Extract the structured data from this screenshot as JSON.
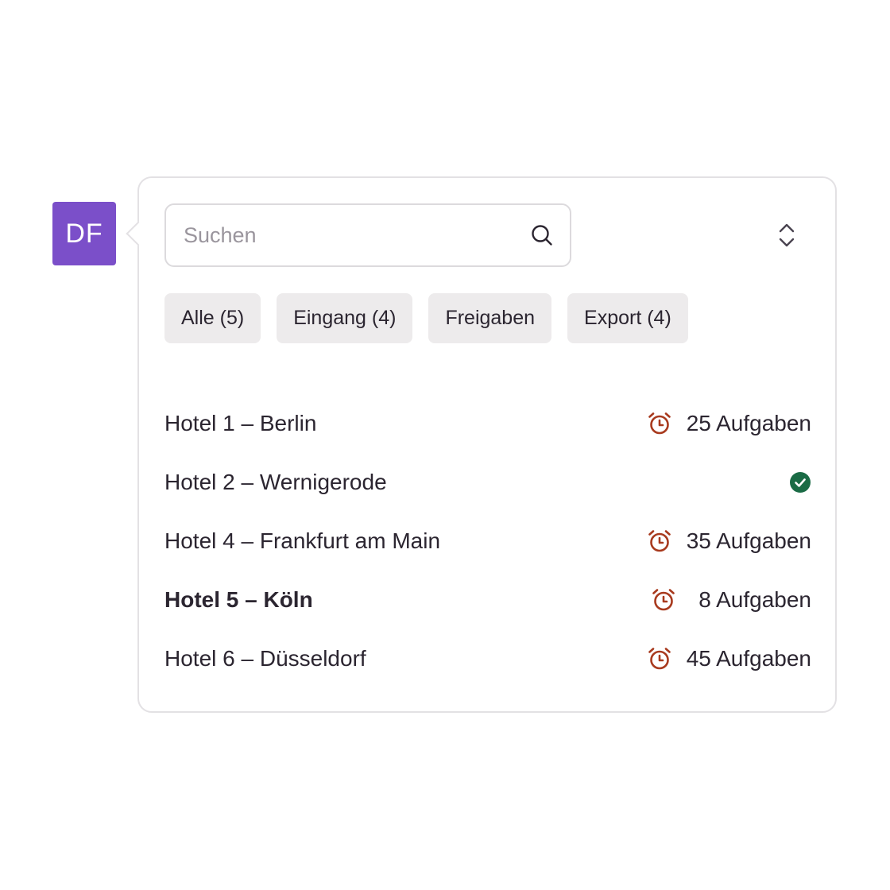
{
  "user": {
    "initials": "DF",
    "avatar_color": "#7b4fc9"
  },
  "search": {
    "placeholder": "Suchen",
    "value": "",
    "icon": "search-icon"
  },
  "sort_toggle": {
    "icon": "chevron-up-down-icon"
  },
  "filters": [
    {
      "label": "Alle (5)"
    },
    {
      "label": "Eingang (4)"
    },
    {
      "label": "Freigaben"
    },
    {
      "label": "Export (4)"
    }
  ],
  "hotels": [
    {
      "name": "Hotel 1 – Berlin",
      "status": "pending",
      "tasks": "25 Aufgaben",
      "icon": "alarm-clock-icon",
      "bold": false
    },
    {
      "name": "Hotel 2 – Wernigerode",
      "status": "done",
      "tasks": "",
      "icon": "check-circle-icon",
      "bold": false
    },
    {
      "name": "Hotel 4 – Frankfurt am Main",
      "status": "pending",
      "tasks": "35 Aufgaben",
      "icon": "alarm-clock-icon",
      "bold": false
    },
    {
      "name": "Hotel 5 – Köln",
      "status": "pending",
      "tasks": "8 Aufgaben",
      "icon": "alarm-clock-icon",
      "bold": true
    },
    {
      "name": "Hotel 6 – Düsseldorf",
      "status": "pending",
      "tasks": "45 Aufgaben",
      "icon": "alarm-clock-icon",
      "bold": false
    }
  ],
  "colors": {
    "alarm": "#a83a1e",
    "done": "#1a6b45",
    "chip_bg": "#edebec",
    "border": "#e3e1e4"
  }
}
